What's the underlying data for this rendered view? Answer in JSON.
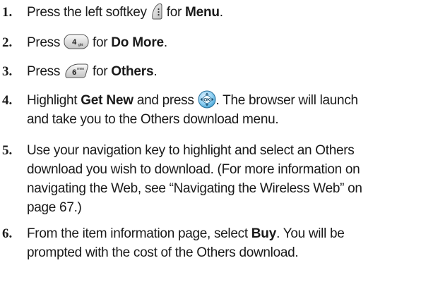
{
  "steps": [
    {
      "number": "1.",
      "before_icon": "Press the left softkey ",
      "icon": "left-softkey-icon",
      "after_icon": " for ",
      "bold": "Menu",
      "end": "."
    },
    {
      "number": "2.",
      "before_icon": "Press ",
      "icon": "key-4-ghi-icon",
      "icon_main": "4",
      "icon_sub": "ghi",
      "after_icon": " for ",
      "bold": "Do More",
      "end": "."
    },
    {
      "number": "3.",
      "before_icon": "Press ",
      "icon": "key-6-mno-icon",
      "icon_main": "6",
      "icon_sub": "mno",
      "after_icon": " for ",
      "bold": "Others",
      "end": "."
    },
    {
      "number": "4.",
      "before_bold": "Highlight ",
      "bold": "Get New",
      "before_icon": " and press ",
      "icon": "ok-key-icon",
      "icon_label": "OK",
      "after_icon": ". The browser will launch",
      "line2": "and take you to the Others download menu."
    },
    {
      "number": "5.",
      "lines": [
        "Use your navigation key to highlight and select an Others",
        "download you wish to download. (For more information on",
        "navigating the Web, see “Navigating the Wireless Web” on",
        "page 67.)"
      ]
    },
    {
      "number": "6.",
      "before_bold": "From the item information page, select ",
      "bold": "Buy",
      "after_bold": ". You will be",
      "line2": "prompted with the cost of the Others download."
    }
  ]
}
